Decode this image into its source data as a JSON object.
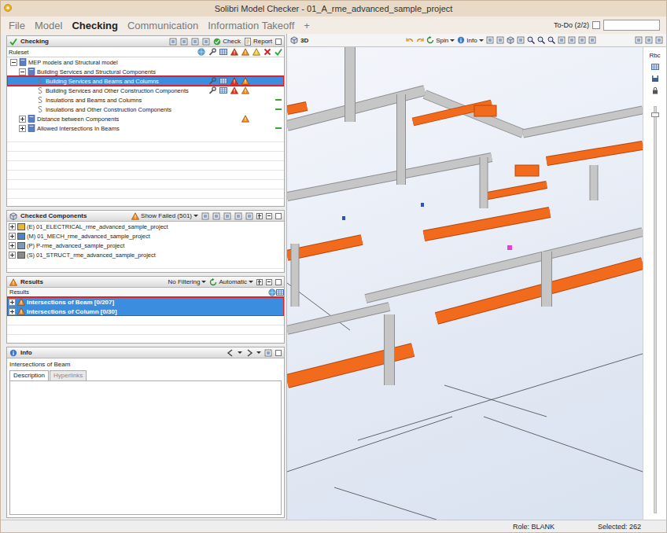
{
  "window": {
    "title": "Solibri Model Checker - 01_A_rme_advanced_sample_project"
  },
  "menu": [
    {
      "label": "File",
      "selected": false
    },
    {
      "label": "Model",
      "selected": false
    },
    {
      "label": "Checking",
      "selected": true
    },
    {
      "label": "Communication",
      "selected": false
    },
    {
      "label": "Information Takeoff",
      "selected": false
    },
    {
      "label": "+",
      "selected": false
    }
  ],
  "todo": {
    "label": "To-Do (2/2)",
    "checked": false
  },
  "checking": {
    "title": "Checking",
    "actions": [
      "Check",
      "Report"
    ],
    "column": "Ruleset",
    "rows": [
      {
        "label": "MEP models and Structural model",
        "depth": 0,
        "kind": "folder",
        "expanded": true,
        "selected": false,
        "outlined": false,
        "statuses": []
      },
      {
        "label": "Building Services and Structural Components",
        "depth": 1,
        "kind": "folder",
        "expanded": true,
        "selected": false,
        "outlined": false,
        "statuses": []
      },
      {
        "label": "Building Services and Beams and Columns",
        "depth": 2,
        "kind": "rule",
        "expanded": false,
        "selected": true,
        "outlined": true,
        "statuses": [
          "wrench",
          "table",
          "critical",
          "warning"
        ]
      },
      {
        "label": "Building Services and Other Construction Components",
        "depth": 2,
        "kind": "rule",
        "expanded": false,
        "selected": false,
        "outlined": false,
        "statuses": [
          "wrench",
          "table",
          "critical",
          "warning"
        ]
      },
      {
        "label": "Insulations and Beams and Columns",
        "depth": 2,
        "kind": "rule",
        "expanded": false,
        "selected": false,
        "outlined": false,
        "statuses": [
          "pass"
        ]
      },
      {
        "label": "Insulations and Other Construction Components",
        "depth": 2,
        "kind": "rule",
        "expanded": false,
        "selected": false,
        "outlined": false,
        "statuses": [
          "pass"
        ]
      },
      {
        "label": "Distance between Components",
        "depth": 1,
        "kind": "folder",
        "expanded": false,
        "selected": false,
        "outlined": false,
        "statuses": [
          "warning"
        ]
      },
      {
        "label": "Allowed Intersections In Beams",
        "depth": 1,
        "kind": "folder",
        "expanded": false,
        "selected": false,
        "outlined": false,
        "statuses": [
          "pass"
        ]
      }
    ]
  },
  "checked_components": {
    "title": "Checked Components",
    "filter": "Show Failed (501)",
    "rows": [
      {
        "label": "(E) 01_ELECTRICAL_rme_advanced_sample_project",
        "expanded": false,
        "color": "#e8b830"
      },
      {
        "label": "(M) 01_MECH_rme_advanced_sample_project",
        "expanded": false,
        "color": "#4a86c8"
      },
      {
        "label": "(P) P-rme_advanced_sample_project",
        "expanded": false,
        "color": "#7a9ac0"
      },
      {
        "label": "(S) 01_STRUCT_rme_advanced_sample_project",
        "expanded": false,
        "color": "#8a8a8a"
      }
    ]
  },
  "results": {
    "title": "Results",
    "filter": "No Filtering",
    "mode": "Automatic",
    "column": "Results",
    "outlined": true,
    "rows": [
      {
        "label": "Intersections of Beam [0/207]",
        "expanded": false,
        "selected": true
      },
      {
        "label": "Intersections of Column [0/30]",
        "expanded": false,
        "selected": true
      }
    ]
  },
  "info": {
    "title": "Info",
    "heading": "Intersections of Beam",
    "tabs": [
      {
        "label": "Description",
        "selected": true
      },
      {
        "label": "Hyperlinks",
        "selected": false
      }
    ]
  },
  "view": {
    "tab": "3D",
    "tools": [
      "Spin",
      "Info"
    ],
    "side_label": "Rbc",
    "slider": {
      "level": 0.98
    }
  },
  "status_bar": {
    "role": "Role: BLANK",
    "selected": "Selected: 262"
  }
}
